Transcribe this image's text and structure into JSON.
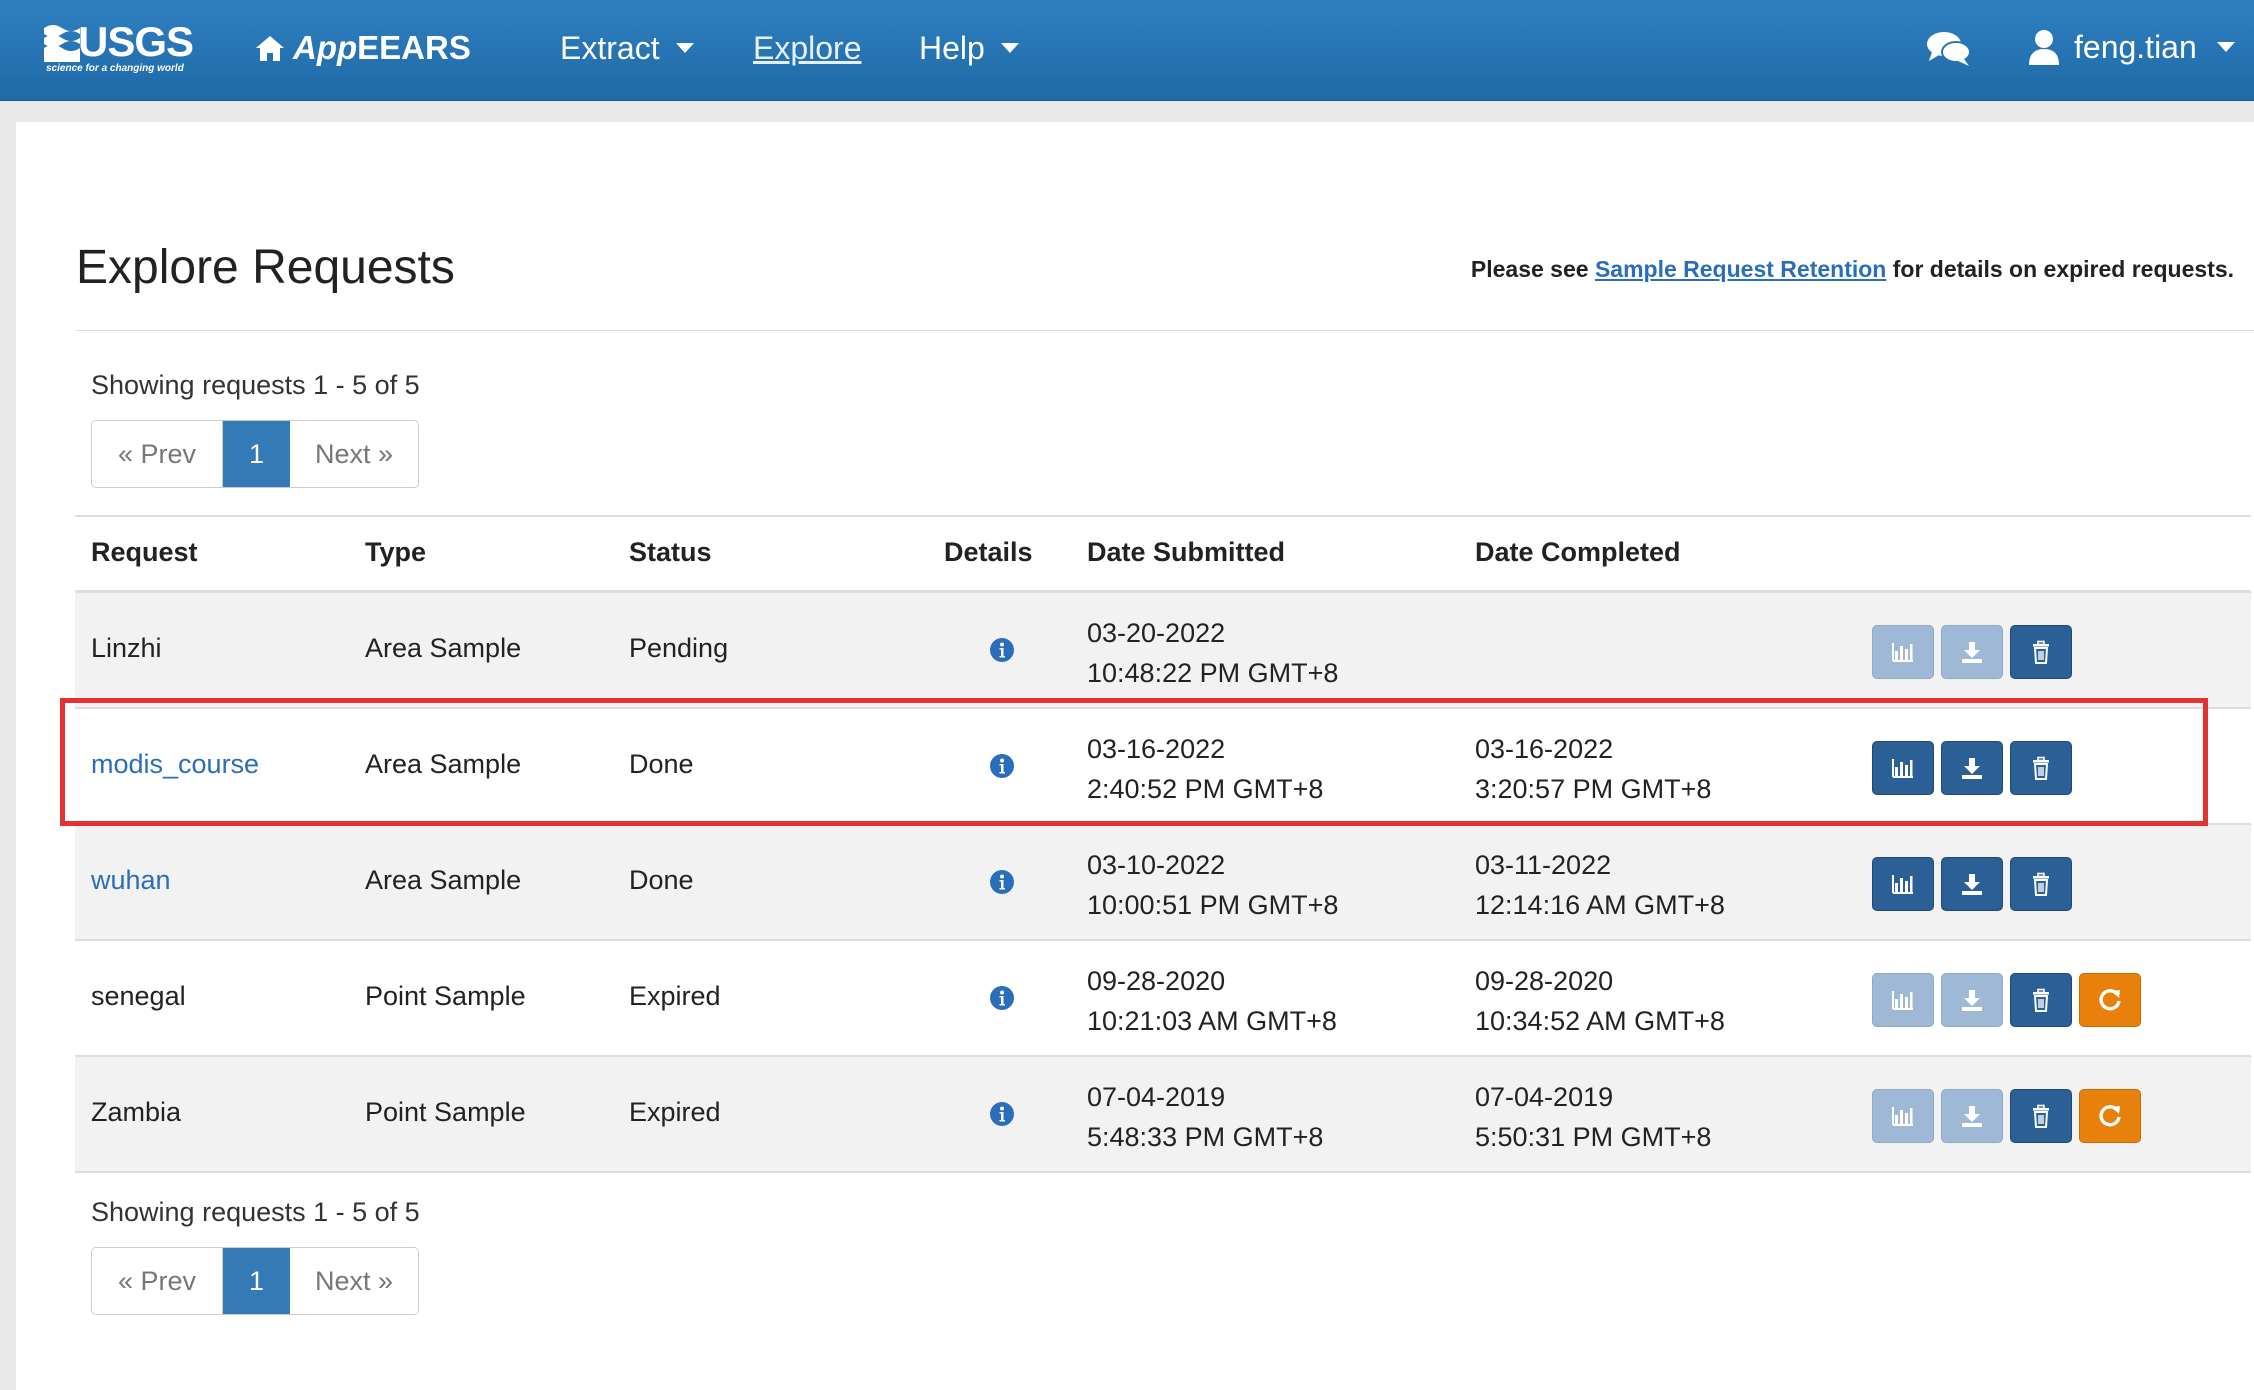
{
  "navbar": {
    "logo_text": "USGS",
    "logo_tagline": "science for a changing world",
    "brand_app": "App",
    "brand_rest": "EEARS",
    "menu": [
      {
        "label": "Extract",
        "dropdown": true
      },
      {
        "label": "Explore",
        "dropdown": false,
        "active": true
      },
      {
        "label": "Help",
        "dropdown": true
      }
    ],
    "chat_icon": "chat-bubbles-icon",
    "username": "feng.tian"
  },
  "page": {
    "title": "Explore Requests",
    "retention_prefix": "Please see ",
    "retention_link": "Sample Request Retention",
    "retention_suffix": " for details on expired requests."
  },
  "pagination": {
    "showing_text": "Showing requests 1 - 5 of 5",
    "prev_label": "« Prev",
    "current_page": "1",
    "next_label": "Next »"
  },
  "table": {
    "headers": {
      "request": "Request",
      "type": "Type",
      "status": "Status",
      "details": "Details",
      "date_submitted": "Date Submitted",
      "date_completed": "Date Completed"
    },
    "rows": [
      {
        "request": "Linzhi",
        "link": false,
        "type": "Area Sample",
        "status": "Pending",
        "submitted_date": "03-20-2022",
        "submitted_time": "10:48:22 PM GMT+8",
        "completed_date": "",
        "completed_time": "",
        "actions": [
          "chart:disabled",
          "download:disabled",
          "delete:primary"
        ],
        "highlighted": true
      },
      {
        "request": "modis_course",
        "link": true,
        "type": "Area Sample",
        "status": "Done",
        "submitted_date": "03-16-2022",
        "submitted_time": "2:40:52 PM GMT+8",
        "completed_date": "03-16-2022",
        "completed_time": "3:20:57 PM GMT+8",
        "actions": [
          "chart:primary",
          "download:primary",
          "delete:primary"
        ]
      },
      {
        "request": "wuhan",
        "link": true,
        "type": "Area Sample",
        "status": "Done",
        "submitted_date": "03-10-2022",
        "submitted_time": "10:00:51 PM GMT+8",
        "completed_date": "03-11-2022",
        "completed_time": "12:14:16 AM GMT+8",
        "actions": [
          "chart:primary",
          "download:primary",
          "delete:primary"
        ]
      },
      {
        "request": "senegal",
        "link": false,
        "type": "Point Sample",
        "status": "Expired",
        "submitted_date": "09-28-2020",
        "submitted_time": "10:21:03 AM GMT+8",
        "completed_date": "09-28-2020",
        "completed_time": "10:34:52 AM GMT+8",
        "actions": [
          "chart:disabled",
          "download:disabled",
          "delete:primary",
          "restart:warning"
        ]
      },
      {
        "request": "Zambia",
        "link": false,
        "type": "Point Sample",
        "status": "Expired",
        "submitted_date": "07-04-2019",
        "submitted_time": "5:48:33 PM GMT+8",
        "completed_date": "07-04-2019",
        "completed_time": "5:50:31 PM GMT+8",
        "actions": [
          "chart:disabled",
          "download:disabled",
          "delete:primary",
          "restart:warning"
        ]
      }
    ]
  },
  "colors": {
    "navbar": "#2574b5",
    "link": "#2a6ebb",
    "primary_button": "#2c5f96",
    "disabled_button": "#9fb8d6",
    "warning_button": "#e8810c",
    "highlight": "#e23232"
  }
}
